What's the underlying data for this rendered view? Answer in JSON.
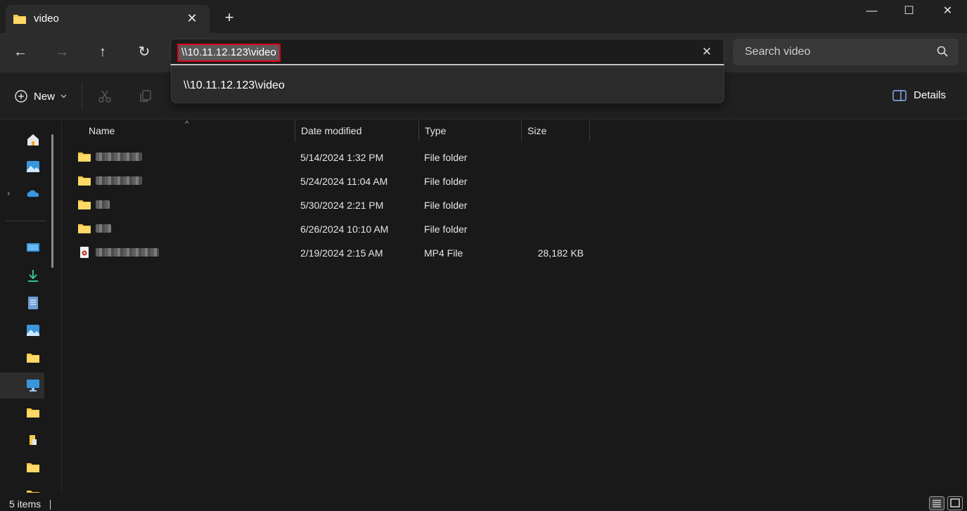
{
  "window": {
    "tab_title": "video",
    "tab_close": "✕",
    "new_tab": "+",
    "minimize": "—",
    "maximize": "☐",
    "close": "✕"
  },
  "nav": {
    "back": "←",
    "forward": "→",
    "up": "↑",
    "refresh": "↻"
  },
  "address": {
    "value": "\\\\10.11.12.123\\video",
    "clear": "✕",
    "suggestion": "\\\\10.11.12.123\\video"
  },
  "search": {
    "placeholder": "Search video"
  },
  "commandbar": {
    "new_label": "New",
    "details_label": "Details"
  },
  "columns": {
    "name": "Name",
    "date": "Date modified",
    "type": "Type",
    "size": "Size"
  },
  "files": [
    {
      "icon": "folder-icon",
      "date": "5/14/2024 1:32 PM",
      "type": "File folder",
      "size": ""
    },
    {
      "icon": "folder-icon",
      "date": "5/24/2024 11:04 AM",
      "type": "File folder",
      "size": ""
    },
    {
      "icon": "folder-icon",
      "date": "5/30/2024 2:21 PM",
      "type": "File folder",
      "size": ""
    },
    {
      "icon": "folder-icon",
      "date": "6/26/2024 10:10 AM",
      "type": "File folder",
      "size": ""
    },
    {
      "icon": "video-file-icon",
      "date": "2/19/2024 2:15 AM",
      "type": "MP4 File",
      "size": "28,182 KB"
    }
  ],
  "status": {
    "items": "5 items"
  },
  "colors": {
    "accent_folder": "#f7c948",
    "highlight_border": "#e0001a",
    "background": "#191919"
  }
}
